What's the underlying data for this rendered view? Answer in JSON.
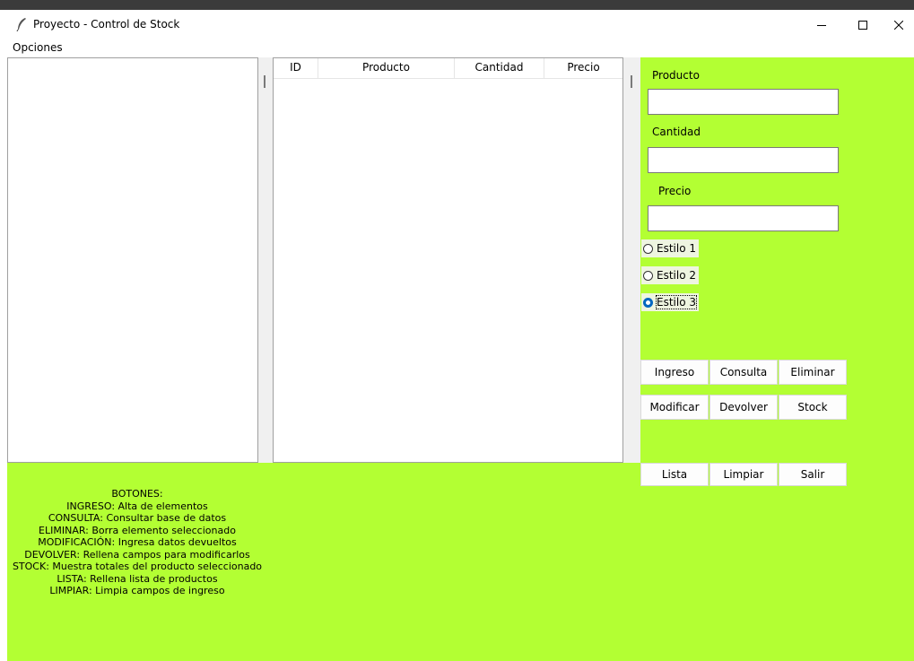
{
  "window": {
    "title": "Proyecto - Control de Stock",
    "icon": "feather-icon",
    "controls": [
      "minimize-icon",
      "maximize-icon",
      "close-icon"
    ]
  },
  "menu": {
    "opciones": "Opciones"
  },
  "table": {
    "columns": [
      "ID",
      "Producto",
      "Cantidad",
      "Precio"
    ],
    "rows": []
  },
  "form": {
    "producto_label": "Producto",
    "producto_value": "",
    "cantidad_label": "Cantidad",
    "cantidad_value": "",
    "precio_label": "Precio",
    "precio_value": ""
  },
  "styles": {
    "options": [
      "Estilo 1",
      "Estilo 2",
      "Estilo 3"
    ],
    "selected": "Estilo 3"
  },
  "buttons": {
    "ingreso": "Ingreso",
    "consulta": "Consulta",
    "eliminar": "Eliminar",
    "modificar": "Modificar",
    "devolver": "Devolver",
    "stock": "Stock",
    "lista": "Lista",
    "limpiar": "Limpiar",
    "salir": "Salir"
  },
  "help": [
    "BOTONES:",
    "INGRESO: Alta de elementos",
    "CONSULTA: Consultar base de datos",
    "ELIMINAR: Borra elemento seleccionado",
    "MODIFICACIÓN: Ingresa datos devueltos",
    "DEVOLVER: Rellena campos para modificarlos",
    "STOCK: Muestra totales del producto seleccionado",
    "LISTA: Rellena lista de productos",
    "LIMPIAR: Limpia campos de ingreso"
  ],
  "colors": {
    "panel_bg": "#b3ff33",
    "radio_accent": "#0067c0"
  }
}
